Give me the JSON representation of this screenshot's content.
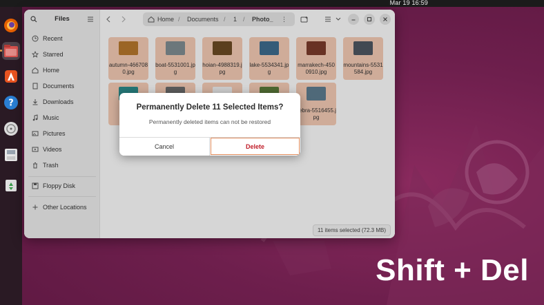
{
  "topbar": {
    "clock": "Mar 19  16:59"
  },
  "window": {
    "title": "Files",
    "sidebar": {
      "items": [
        {
          "label": "Recent",
          "icon": "clock-icon"
        },
        {
          "label": "Starred",
          "icon": "star-icon"
        },
        {
          "label": "Home",
          "icon": "home-icon"
        },
        {
          "label": "Documents",
          "icon": "document-icon"
        },
        {
          "label": "Downloads",
          "icon": "download-icon"
        },
        {
          "label": "Music",
          "icon": "music-icon"
        },
        {
          "label": "Pictures",
          "icon": "pictures-icon"
        },
        {
          "label": "Videos",
          "icon": "video-icon"
        },
        {
          "label": "Trash",
          "icon": "trash-icon"
        }
      ],
      "devices": [
        {
          "label": "Floppy Disk",
          "icon": "floppy-icon"
        }
      ],
      "other": {
        "label": "Other Locations",
        "icon": "plus-icon"
      }
    },
    "path": {
      "home": "Home",
      "documents": "Documents",
      "one": "1",
      "current": "Photo_"
    },
    "files_row1": [
      {
        "name": "autumn-4667080.jpg",
        "color": "#b5762c"
      },
      {
        "name": "boat-5531001.jpg",
        "color": "#7e8b90"
      },
      {
        "name": "hoian-4988319.jpg",
        "color": "#6a4a24"
      },
      {
        "name": "lake-5534341.jpg",
        "color": "#3d6b8c"
      },
      {
        "name": "marrakech-4500910.jpg",
        "color": "#7a3b2a"
      },
      {
        "name": "mountains-5531584.jpg",
        "color": "#4d5560"
      }
    ],
    "files_row2": [
      {
        "name": "P",
        "color": "#2a8a8a"
      },
      {
        "name": "",
        "color": "#6a6a6a"
      },
      {
        "name": "",
        "color": "#eeeeee"
      },
      {
        "name": "",
        "color": "#5a7a3a"
      },
      {
        "name": "zebra-5516455.jpg",
        "color": "#5d7b8d"
      }
    ],
    "status": "11 items selected (72.3 MB)"
  },
  "dialog": {
    "title": "Permanently Delete 11 Selected Items?",
    "message": "Permanently deleted items can not be restored",
    "cancel": "Cancel",
    "delete": "Delete"
  },
  "caption": "Shift + Del"
}
